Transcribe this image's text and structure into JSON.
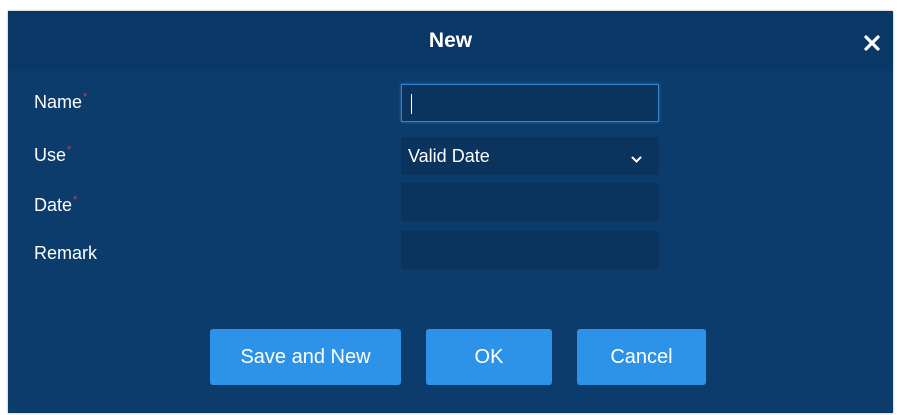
{
  "dialog": {
    "title": "New",
    "close_icon": "close-icon"
  },
  "form": {
    "name_label": "Name",
    "use_label": "Use",
    "date_label": "Date",
    "remark_label": "Remark",
    "required_marker": "*",
    "name_value": "",
    "use_value": "Valid Date",
    "date_value": "",
    "remark_value": ""
  },
  "buttons": {
    "save_and_new": "Save and New",
    "ok": "OK",
    "cancel": "Cancel"
  },
  "colors": {
    "dialog_bg": "#0c3c6b",
    "header_bg": "#0a3866",
    "field_bg": "#0a335d",
    "button_bg": "#2d93e8",
    "required": "#d6334a",
    "focus_border": "#2f86d6"
  }
}
